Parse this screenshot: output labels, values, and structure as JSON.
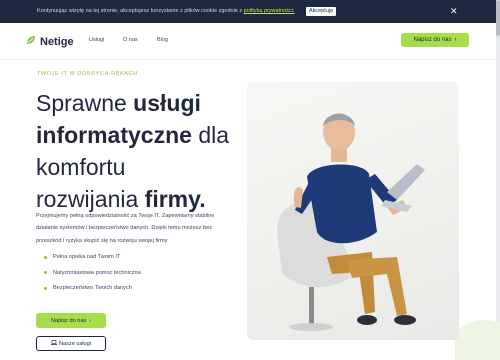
{
  "cookie": {
    "text": "Kontynuując wizytę na tej stronie, akceptujesz korzystanie z plików cookie zgodnie z ",
    "link": "polityką prywatności.",
    "accept": "Akceptuję",
    "close_icon": "close-icon"
  },
  "brand": {
    "name": "Netige",
    "logo_icon": "leaf-icon",
    "accent": "#a7dd4a",
    "dark": "#1c2940"
  },
  "nav": {
    "items": [
      "Usługi",
      "O nas",
      "Blog"
    ],
    "cta": "Napisz do nas"
  },
  "hero": {
    "eyebrow": "TWOJE IT W DOBRYCH RĘKACH",
    "headline": {
      "l1a": "Sprawne ",
      "l1b": "usługi",
      "l2a": "informatyczne",
      "l2b": " dla",
      "l3": "komfortu",
      "l4a": "rozwijania ",
      "l4b": "firmy."
    },
    "lead": "Przejmujemy pełną odpowiedzialność za Twoje IT. Zapewniamy stabilne działanie systemów i bezpieczeństwo danych. Dzięki temu możesz bez przeszkód i ryzyka skupić się na rozwoju swojej firmy",
    "bullets": [
      "Pełna opieka nad Twoim IT",
      "Natychmiastowa pomoc techniczna",
      "Bezpieczeństwo Twoich danych"
    ],
    "primary_btn": "Napisz do nas",
    "secondary_btn": "Nasze usługi",
    "secondary_icon": "laptop-icon",
    "image_icon": "person-with-laptop-illustration"
  }
}
